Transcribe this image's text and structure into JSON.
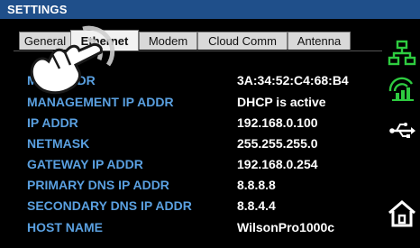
{
  "header": {
    "title": "SETTINGS"
  },
  "tabs": [
    {
      "label": "General",
      "active": false
    },
    {
      "label": "Ethernet",
      "active": true
    },
    {
      "label": "Modem",
      "active": false
    },
    {
      "label": "Cloud Comm",
      "active": false
    },
    {
      "label": "Antenna",
      "active": false
    }
  ],
  "ethernet": {
    "rows": [
      {
        "label": "MAC ADDR",
        "value": "3A:34:52:C4:68:B4"
      },
      {
        "label": "MANAGEMENT IP ADDR",
        "value": "DHCP is active"
      },
      {
        "label": "IP ADDR",
        "value": "192.168.0.100"
      },
      {
        "label": "NETMASK",
        "value": "255.255.255.0"
      },
      {
        "label": "GATEWAY IP ADDR",
        "value": "192.168.0.254"
      },
      {
        "label": "PRIMARY DNS IP ADDR",
        "value": "8.8.8.8"
      },
      {
        "label": "SECONDARY DNS IP ADDR",
        "value": "8.8.4.4"
      },
      {
        "label": "HOST NAME",
        "value": "WilsonPro1000c"
      }
    ]
  },
  "sidebar": {
    "icons": [
      "network-icon",
      "signal-icon",
      "usb-icon",
      "home-icon"
    ]
  },
  "overlay": {
    "icon": "touch-hand-icon"
  },
  "colors": {
    "header_bg": "#1f4f8a",
    "label": "#5aa0e0",
    "value": "#ffffff",
    "accent_green": "#2ecc40"
  }
}
